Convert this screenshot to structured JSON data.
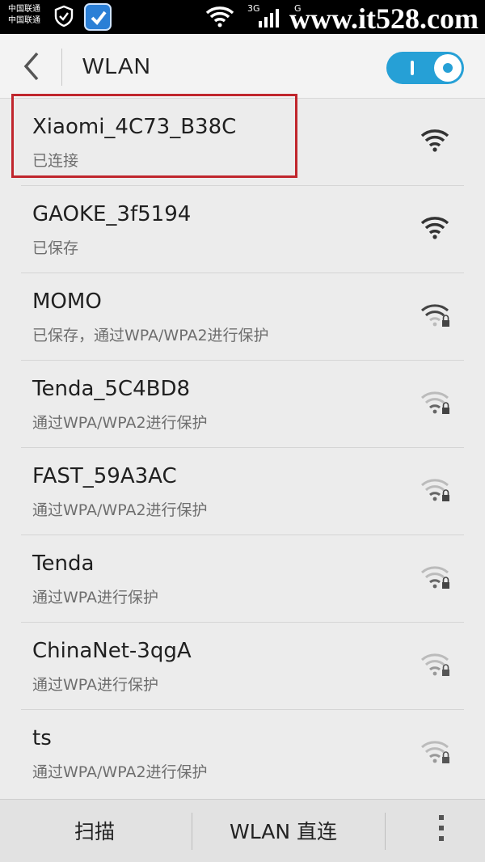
{
  "status_bar": {
    "carrier_1": "中国联通",
    "carrier_2": "中国联通",
    "network": "3G",
    "network_2": "G",
    "watermark": "www.it528.com"
  },
  "header": {
    "title": "WLAN",
    "wlan_enabled": true
  },
  "networks": [
    {
      "ssid": "Xiaomi_4C73_B38C",
      "status": "已连接",
      "signal": "full",
      "secured": false,
      "highlighted": true
    },
    {
      "ssid": "GAOKE_3f5194",
      "status": "已保存",
      "signal": "full",
      "secured": false
    },
    {
      "ssid": "MOMO",
      "status": "已保存，通过WPA/WPA2进行保护",
      "signal": "high",
      "secured": true
    },
    {
      "ssid": "Tenda_5C4BD8",
      "status": "通过WPA/WPA2进行保护",
      "signal": "low",
      "secured": true
    },
    {
      "ssid": "FAST_59A3AC",
      "status": "通过WPA/WPA2进行保护",
      "signal": "low",
      "secured": true
    },
    {
      "ssid": "Tenda",
      "status": "通过WPA进行保护",
      "signal": "low",
      "secured": true
    },
    {
      "ssid": "ChinaNet-3qgA",
      "status": "通过WPA进行保护",
      "signal": "low",
      "secured": true
    },
    {
      "ssid": "ts",
      "status": "通过WPA/WPA2进行保护",
      "signal": "low",
      "secured": true
    }
  ],
  "bottom_bar": {
    "scan_label": "扫描",
    "direct_label": "WLAN 直连"
  },
  "colors": {
    "accent": "#26a0d6",
    "highlight_border": "#c0262d"
  }
}
